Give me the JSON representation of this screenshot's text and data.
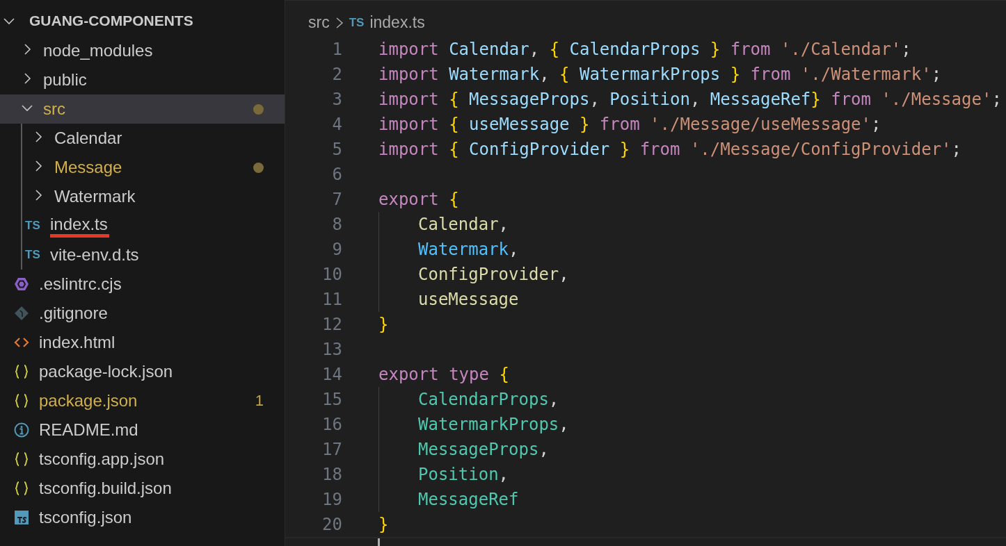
{
  "explorer": {
    "title": "GUANG-COMPONENTS",
    "expanded": true,
    "items": [
      {
        "kind": "folder",
        "label": "node_modules",
        "expanded": false,
        "selected": false,
        "modified": false
      },
      {
        "kind": "folder",
        "label": "public",
        "expanded": false,
        "selected": false,
        "modified": false
      },
      {
        "kind": "folder",
        "label": "src",
        "expanded": true,
        "selected": true,
        "modified": true,
        "children": [
          {
            "kind": "folder",
            "label": "Calendar",
            "expanded": false,
            "selected": false,
            "modified": false
          },
          {
            "kind": "folder",
            "label": "Message",
            "expanded": false,
            "selected": false,
            "modified": true
          },
          {
            "kind": "folder",
            "label": "Watermark",
            "expanded": false,
            "selected": false,
            "modified": false
          },
          {
            "kind": "ts",
            "icon_text": "TS",
            "label": "index.ts",
            "selected": false,
            "modified": false,
            "underlined": true
          },
          {
            "kind": "ts",
            "icon_text": "TS",
            "label": "vite-env.d.ts",
            "selected": false,
            "modified": false,
            "underlined": false
          }
        ]
      },
      {
        "kind": "eslint",
        "label": ".eslintrc.cjs",
        "selected": false,
        "modified": false
      },
      {
        "kind": "git",
        "label": ".gitignore",
        "selected": false,
        "modified": false
      },
      {
        "kind": "html",
        "label": "index.html",
        "selected": false,
        "modified": false
      },
      {
        "kind": "json",
        "label": "package-lock.json",
        "selected": false,
        "modified": false
      },
      {
        "kind": "json",
        "label": "package.json",
        "selected": false,
        "modified": true,
        "badge": "1"
      },
      {
        "kind": "info",
        "label": "README.md",
        "selected": false,
        "modified": false
      },
      {
        "kind": "json",
        "label": "tsconfig.app.json",
        "selected": false,
        "modified": false
      },
      {
        "kind": "json",
        "label": "tsconfig.build.json",
        "selected": false,
        "modified": false
      },
      {
        "kind": "tsconfig",
        "label": "tsconfig.json",
        "selected": false,
        "modified": false
      }
    ]
  },
  "breadcrumb": {
    "folder": "src",
    "file_icon_text": "TS",
    "file": "index.ts"
  },
  "editor": {
    "lines": [
      {
        "number": "1",
        "indented": false,
        "tokens": [
          {
            "text": "import",
            "kind": "keyword",
            "space": true
          },
          {
            "text": "Calendar",
            "kind": "variable"
          },
          {
            "text": ",",
            "kind": "punct",
            "space": true
          },
          {
            "text": "{",
            "kind": "brace",
            "space": true
          },
          {
            "text": "CalendarProps",
            "kind": "variable",
            "space": true
          },
          {
            "text": "}",
            "kind": "brace",
            "space": true
          },
          {
            "text": "from",
            "kind": "keyword",
            "space": true
          },
          {
            "text": "'./Calendar'",
            "kind": "string"
          },
          {
            "text": ";",
            "kind": "punct"
          }
        ]
      },
      {
        "number": "2",
        "indented": false,
        "tokens": [
          {
            "text": "import",
            "kind": "keyword",
            "space": true
          },
          {
            "text": "Watermark",
            "kind": "variable"
          },
          {
            "text": ",",
            "kind": "punct",
            "space": true
          },
          {
            "text": "{",
            "kind": "brace",
            "space": true
          },
          {
            "text": "WatermarkProps",
            "kind": "variable",
            "space": true
          },
          {
            "text": "}",
            "kind": "brace",
            "space": true
          },
          {
            "text": "from",
            "kind": "keyword",
            "space": true
          },
          {
            "text": "'./Watermark'",
            "kind": "string"
          },
          {
            "text": ";",
            "kind": "punct"
          }
        ]
      },
      {
        "number": "3",
        "indented": false,
        "tokens": [
          {
            "text": "import",
            "kind": "keyword",
            "space": true
          },
          {
            "text": "{",
            "kind": "brace",
            "space": true
          },
          {
            "text": "MessageProps",
            "kind": "variable"
          },
          {
            "text": ",",
            "kind": "punct",
            "space": true
          },
          {
            "text": "Position",
            "kind": "variable"
          },
          {
            "text": ",",
            "kind": "punct",
            "space": true
          },
          {
            "text": "MessageRef",
            "kind": "variable"
          },
          {
            "text": "}",
            "kind": "brace",
            "space": true
          },
          {
            "text": "from",
            "kind": "keyword",
            "space": true
          },
          {
            "text": "'./Message'",
            "kind": "string"
          },
          {
            "text": ";",
            "kind": "punct"
          }
        ]
      },
      {
        "number": "4",
        "indented": false,
        "tokens": [
          {
            "text": "import",
            "kind": "keyword",
            "space": true
          },
          {
            "text": "{",
            "kind": "brace",
            "space": true
          },
          {
            "text": "useMessage",
            "kind": "variable",
            "space": true
          },
          {
            "text": "}",
            "kind": "brace",
            "space": true
          },
          {
            "text": "from",
            "kind": "keyword",
            "space": true
          },
          {
            "text": "'./Message/useMessage'",
            "kind": "string"
          },
          {
            "text": ";",
            "kind": "punct"
          }
        ]
      },
      {
        "number": "5",
        "indented": false,
        "tokens": [
          {
            "text": "import",
            "kind": "keyword",
            "space": true
          },
          {
            "text": "{",
            "kind": "brace",
            "space": true
          },
          {
            "text": "ConfigProvider",
            "kind": "variable",
            "space": true
          },
          {
            "text": "}",
            "kind": "brace",
            "space": true
          },
          {
            "text": "from",
            "kind": "keyword",
            "space": true
          },
          {
            "text": "'./Message/ConfigProvider'",
            "kind": "string"
          },
          {
            "text": ";",
            "kind": "punct"
          }
        ]
      },
      {
        "number": "6",
        "indented": false
      },
      {
        "number": "7",
        "indented": false,
        "tokens": [
          {
            "text": "export",
            "kind": "keyword",
            "space": true
          },
          {
            "text": "{",
            "kind": "brace"
          }
        ]
      },
      {
        "number": "8",
        "indented": true,
        "tokens": [
          {
            "text": "Calendar",
            "kind": "function"
          },
          {
            "text": ",",
            "kind": "punct"
          }
        ]
      },
      {
        "number": "9",
        "indented": true,
        "tokens": [
          {
            "text": "Watermark",
            "kind": "constant"
          },
          {
            "text": ",",
            "kind": "punct"
          }
        ]
      },
      {
        "number": "10",
        "indented": true,
        "tokens": [
          {
            "text": "ConfigProvider",
            "kind": "function"
          },
          {
            "text": ",",
            "kind": "punct"
          }
        ]
      },
      {
        "number": "11",
        "indented": true,
        "tokens": [
          {
            "text": "useMessage",
            "kind": "function"
          }
        ]
      },
      {
        "number": "12",
        "indented": false,
        "tokens": [
          {
            "text": "}",
            "kind": "brace"
          }
        ]
      },
      {
        "number": "13",
        "indented": false
      },
      {
        "number": "14",
        "indented": false,
        "tokens": [
          {
            "text": "export",
            "kind": "keyword",
            "space": true
          },
          {
            "text": "type",
            "kind": "keyword",
            "space": true
          },
          {
            "text": "{",
            "kind": "brace"
          }
        ]
      },
      {
        "number": "15",
        "indented": true,
        "tokens": [
          {
            "text": "CalendarProps",
            "kind": "type"
          },
          {
            "text": ",",
            "kind": "punct"
          }
        ]
      },
      {
        "number": "16",
        "indented": true,
        "tokens": [
          {
            "text": "WatermarkProps",
            "kind": "type"
          },
          {
            "text": ",",
            "kind": "punct"
          }
        ]
      },
      {
        "number": "17",
        "indented": true,
        "tokens": [
          {
            "text": "MessageProps",
            "kind": "type"
          },
          {
            "text": ",",
            "kind": "punct"
          }
        ]
      },
      {
        "number": "18",
        "indented": true,
        "tokens": [
          {
            "text": "Position",
            "kind": "type"
          },
          {
            "text": ",",
            "kind": "punct"
          }
        ]
      },
      {
        "number": "19",
        "indented": true,
        "tokens": [
          {
            "text": "MessageRef",
            "kind": "type"
          }
        ]
      },
      {
        "number": "20",
        "indented": false,
        "tokens": [
          {
            "text": "}",
            "kind": "brace"
          }
        ]
      }
    ]
  }
}
